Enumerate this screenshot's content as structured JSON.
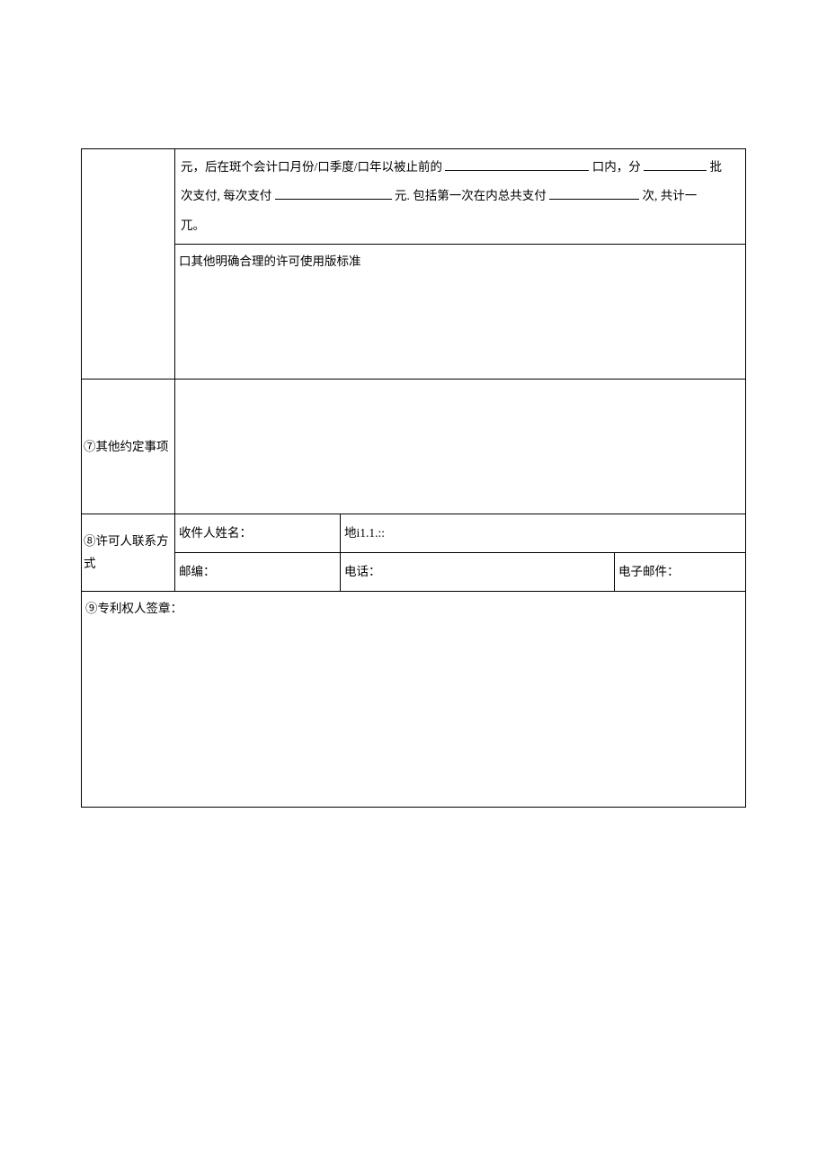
{
  "payment": {
    "prefix": "元，后在斑个会计口月份/口季度/口年以被止前的",
    "within_suffix": "口内，分",
    "batch_suffix": "批",
    "line2_a": "次支付, 每次支付",
    "line2_b": "元. 包括第一次在内总共支付",
    "line2_c": "次, 共计一",
    "line3": "兀。"
  },
  "other_standard": {
    "label": "口其他明确合理的许可使用版标准"
  },
  "row7": {
    "label": "⑦其他约定事项"
  },
  "row8": {
    "label": "⑧许可人联系方式",
    "recipient": "收件人姓名：",
    "addr": "地i1.1.::",
    "zip": "邮编：",
    "phone": "电话：",
    "email": "电子邮件："
  },
  "row9": {
    "label": "⑨专利权人签章："
  }
}
